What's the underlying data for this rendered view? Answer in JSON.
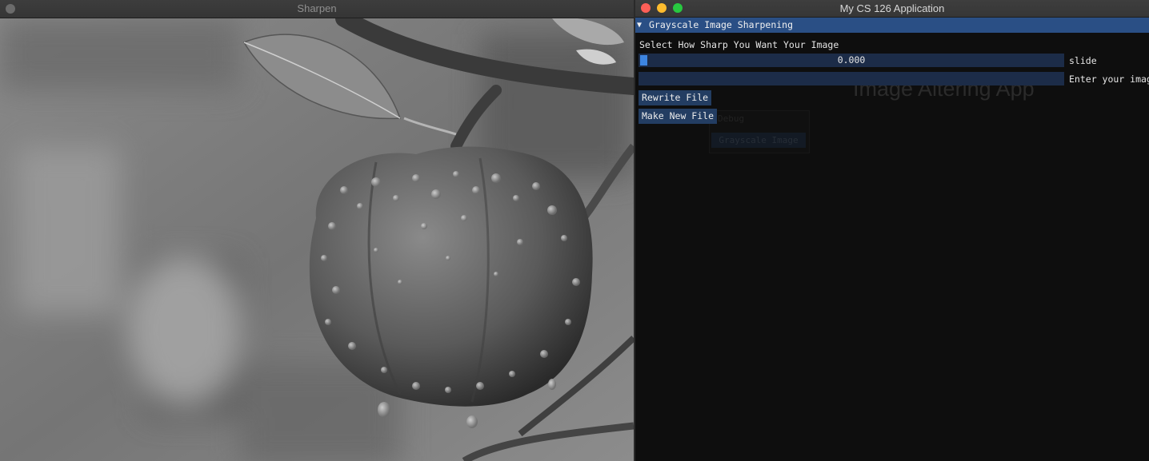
{
  "image_window": {
    "title": "Sharpen"
  },
  "app_window": {
    "title": "My CS 126 Application",
    "background_heading": "Image Altering App",
    "section_header": {
      "arrow": "▼",
      "label": "Grayscale Image Sharpening"
    },
    "prompt": "Select How Sharp You Want Your Image",
    "slider": {
      "value": "0.000",
      "label": "slide",
      "fraction": 0.0
    },
    "text_input": {
      "value": "",
      "label": "Enter your image"
    },
    "buttons": {
      "rewrite": "Rewrite File",
      "new_file": "Make New File"
    },
    "ghost_panel": {
      "title": "Debug",
      "button": "Grayscale Image"
    }
  },
  "colors": {
    "header_bar": "#2a4f85",
    "widget_bg": "#1c2c48",
    "button_bg": "#233d62",
    "slider_grab": "#3d85e0",
    "close": "#fe5f57",
    "minimize": "#febc2e",
    "zoom": "#28c840"
  }
}
